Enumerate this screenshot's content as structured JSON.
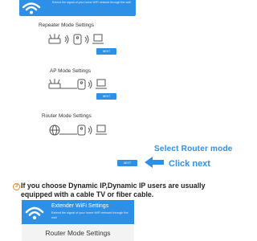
{
  "top_banner": {
    "subtitle": "Extend the signal of your home WiFi network through the wall"
  },
  "modes": [
    {
      "title": "Repeater Mode Settings",
      "button": "NEXT"
    },
    {
      "title": "AP Mode Settings",
      "button": "NEXT"
    },
    {
      "title": "Router Mode Settings",
      "button": "NEXT"
    }
  ],
  "callouts": {
    "select": "Select Router mode",
    "click": "Click next"
  },
  "note": {
    "number": "3",
    "line1": "If you choose Dynamic IP,Dynamic IP users are usually",
    "line2": "equipped with a cable TV or fiber cable."
  },
  "card": {
    "title": "Extender WiFi Settings",
    "subtitle": "Extend the signal of your home WiFi network through the wall",
    "section": "Router Mode Settings"
  },
  "colors": {
    "accent": "#2e8fe6",
    "note_number": "#e4882a"
  },
  "icons": [
    "wifi-logo-icon",
    "router-icon",
    "wifi-signal-icon",
    "extender-icon",
    "laptop-icon",
    "globe-icon",
    "arrow-left-icon"
  ]
}
